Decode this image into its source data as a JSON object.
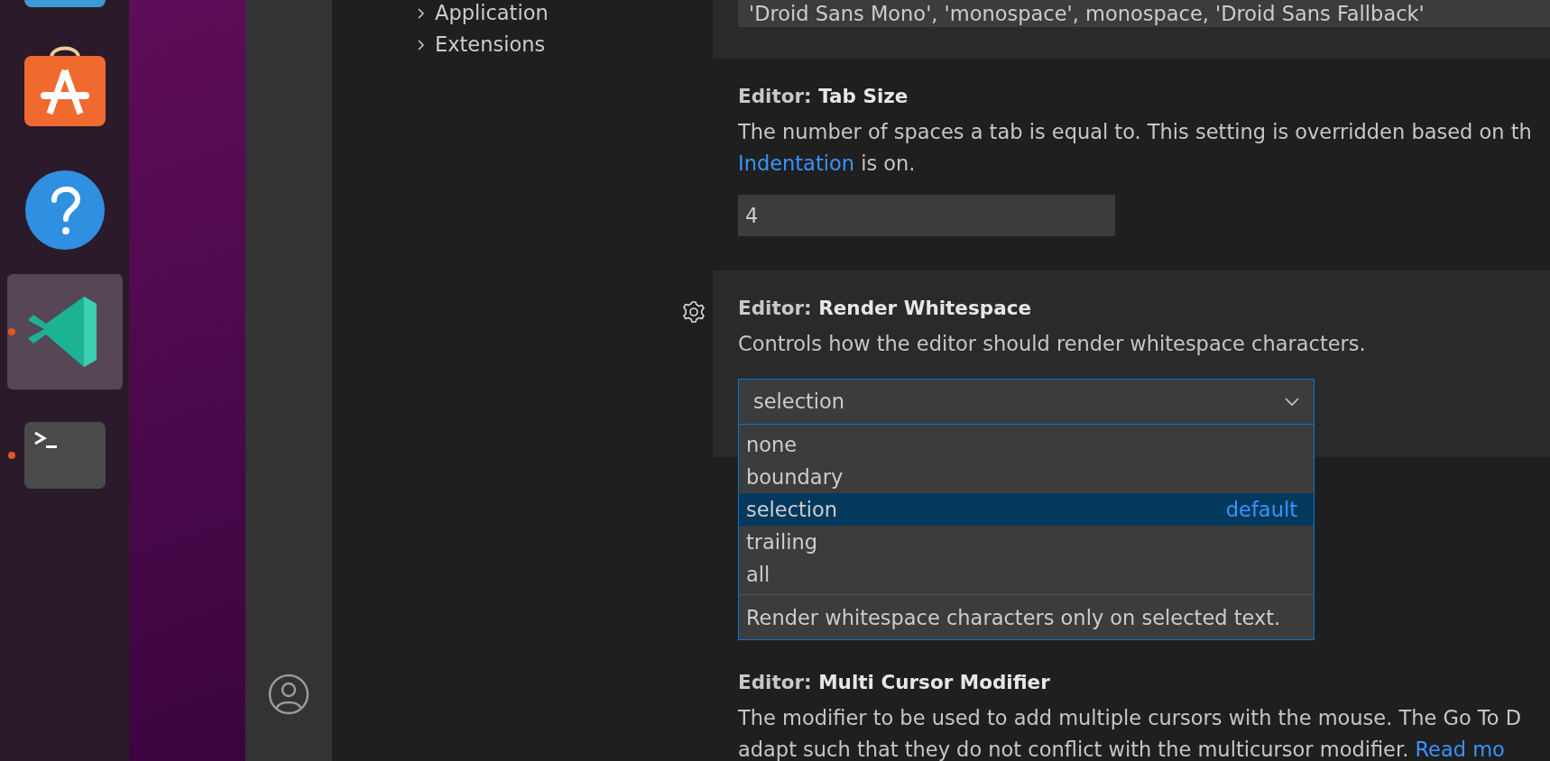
{
  "dock": {
    "apps": [
      {
        "kind": "files",
        "running": false,
        "selected": false
      },
      {
        "kind": "store",
        "running": false,
        "selected": false
      },
      {
        "kind": "help",
        "running": false,
        "selected": false
      },
      {
        "kind": "code",
        "running": true,
        "selected": true
      },
      {
        "kind": "terminal",
        "running": true,
        "selected": false
      }
    ]
  },
  "sidebar": {
    "items": [
      {
        "label": "Application",
        "expanded": false
      },
      {
        "label": "Extensions",
        "expanded": false
      }
    ]
  },
  "settings": [
    {
      "kind": "text",
      "value": "'Droid Sans Mono', 'monospace', monospace, 'Droid Sans Fallback'"
    },
    {
      "kind": "number",
      "focused": false,
      "category": "Editor:",
      "title": "Tab Size",
      "description": [
        [
          {
            "kind": "text",
            "text": "The number of spaces a tab is equal to. This setting is overridden based on th"
          }
        ],
        [
          {
            "kind": "link",
            "text": "Indentation"
          },
          {
            "kind": "text",
            "text": " is on."
          }
        ]
      ],
      "value": "4"
    },
    {
      "kind": "select",
      "focused": true,
      "category": "Editor:",
      "title": "Render Whitespace",
      "description": [
        [
          {
            "kind": "text",
            "text": "Controls how the editor should render whitespace characters."
          }
        ]
      ],
      "value": "selection",
      "expanded": true,
      "options": [
        {
          "label": "none",
          "selected": false
        },
        {
          "label": "boundary",
          "selected": false
        },
        {
          "label": "selection",
          "selected": true,
          "tag": "default"
        },
        {
          "label": "trailing",
          "selected": false
        },
        {
          "label": "all",
          "selected": false
        }
      ],
      "option_description": "Render whitespace characters only on selected text."
    },
    {
      "kind": "note",
      "focused": false,
      "category": "Editor:",
      "title": "Multi Cursor Modifier",
      "description": [
        [
          {
            "kind": "text",
            "text": "The modifier to be used to add multiple cursors with the mouse. The Go To D"
          }
        ],
        [
          {
            "kind": "text",
            "text": "adapt such that they do not conflict with the multicursor modifier. "
          },
          {
            "kind": "link",
            "text": "Read mo"
          }
        ]
      ]
    }
  ]
}
